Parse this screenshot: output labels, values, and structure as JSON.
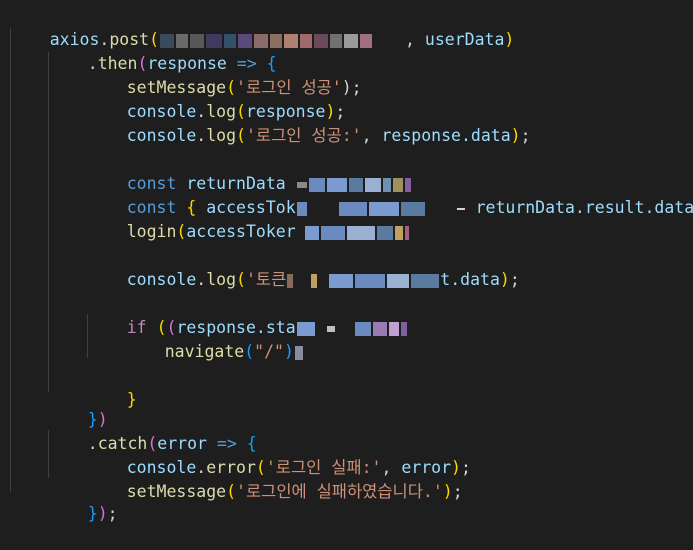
{
  "editor": {
    "line1": {
      "obj": "axios",
      "dot": ".",
      "method": "post",
      "open_paren": "(",
      "comma": ",",
      "arg": "userData",
      "close_paren": ")"
    },
    "line2": {
      "dot": ".",
      "method": "then",
      "open_paren": "(",
      "param": "response",
      "arrow": "=>",
      "open_brace": "{"
    },
    "line3": {
      "fn": "setMessage",
      "open_paren": "(",
      "str": "'로그인 성공'",
      "close": ");"
    },
    "line4": {
      "obj": "console",
      "dot": ".",
      "fn": "log",
      "open_paren": "(",
      "arg": "response",
      "close_paren": ")",
      "semi": ";"
    },
    "line5": {
      "obj": "console",
      "dot": ".",
      "fn": "log",
      "open_paren": "(",
      "str": "'로그인 성공:'",
      "comma": ",",
      "arg": "response.data",
      "close_paren": ")",
      "semi": ";"
    },
    "line7": {
      "kw": "const",
      "name": "returnData"
    },
    "line8": {
      "kw": "const",
      "open_brace": "{",
      "name": "accessTok",
      "rhs": "returnData.result.data",
      "semi": ";"
    },
    "line9": {
      "fn": "login",
      "open_paren": "(",
      "arg": "accessToker"
    },
    "line11": {
      "obj": "console",
      "dot": ".",
      "fn": "log",
      "open_paren": "(",
      "str": "'토큰",
      "tail": "t.data",
      "close_paren": ")",
      "semi": ";"
    },
    "line13": {
      "kw": "if",
      "open_paren": "(",
      "open_paren2": "(",
      "expr": "response.sta"
    },
    "line14": {
      "fn": "navigate",
      "open_paren": "(",
      "str": "\"/\"",
      "close_paren": ")"
    },
    "line16": {
      "close_brace": "}"
    },
    "line17": {
      "close_brace": "}",
      "close_paren": ")"
    },
    "line18": {
      "dot": ".",
      "method": "catch",
      "open_paren": "(",
      "param": "error",
      "arrow": "=>",
      "open_brace": "{"
    },
    "line19": {
      "obj": "console",
      "dot": ".",
      "fn": "error",
      "open_paren": "(",
      "str": "'로그인 실패:'",
      "comma": ",",
      "arg": "error",
      "close_paren": ")",
      "semi": ";"
    },
    "line20": {
      "fn": "setMessage",
      "open_paren": "(",
      "str": "'로그인에 실패하였습니다.'",
      "close_paren": ")",
      "semi": ";"
    },
    "line21": {
      "close_brace": "}",
      "close_paren": ")",
      "semi": ";"
    }
  },
  "colors": {
    "background": "#1e1e1e",
    "variable": "#9cdcfe",
    "function": "#dcdcaa",
    "string": "#ce9178",
    "keyword": "#569cd6",
    "control": "#c586c0",
    "bracket_gold": "#ffd700",
    "bracket_pink": "#da70d6",
    "bracket_blue": "#179fff"
  }
}
